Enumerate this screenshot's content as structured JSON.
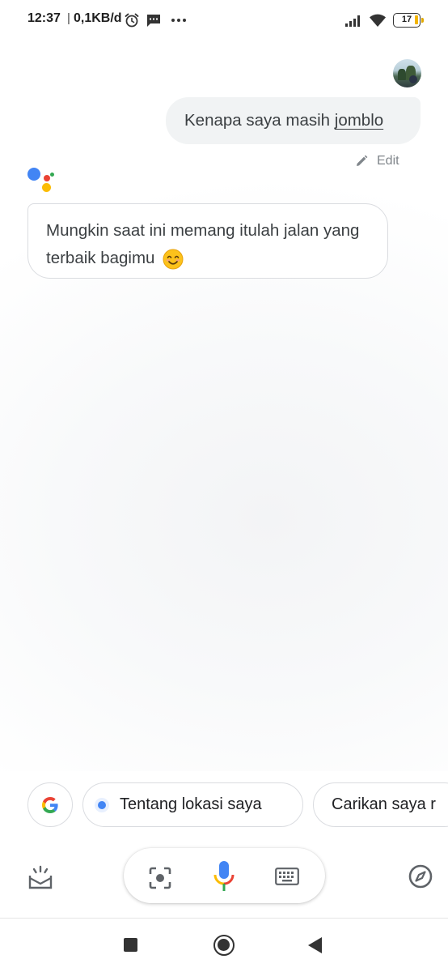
{
  "status_bar": {
    "time": "12:37",
    "separator": "|",
    "net_speed": "0,1KB/d",
    "battery": "17",
    "icons": [
      "alarm-icon",
      "message-icon",
      "more-dots-icon",
      "signal-icon",
      "wifi-icon",
      "battery-icon"
    ]
  },
  "conversation": {
    "user_query_prefix": "Kenapa saya masih ",
    "user_query_underlined": "jomblo",
    "edit_label": "Edit",
    "assistant_reply": "Mungkin saat ini memang itulah jalan yang terbaik bagimu",
    "assistant_emoji": "smiling-face-emoji"
  },
  "suggestions": {
    "google_chip": "google-g-icon",
    "chips": [
      "Tentang lokasi saya",
      "Carikan saya r"
    ]
  },
  "toolbar": {
    "left_icon": "snapshot-icon",
    "center_icons": [
      "lens-icon",
      "mic-icon",
      "keyboard-icon"
    ],
    "right_icon": "explore-compass-icon"
  },
  "navigation": {
    "buttons": [
      "recents",
      "home",
      "back"
    ]
  },
  "colors": {
    "google_blue": "#4285f4",
    "google_red": "#ea4335",
    "google_yellow": "#fbbc04",
    "google_green": "#34a853",
    "bubble_grey": "#f1f3f4",
    "text_dark": "#3c4043",
    "muted": "#80868b"
  }
}
